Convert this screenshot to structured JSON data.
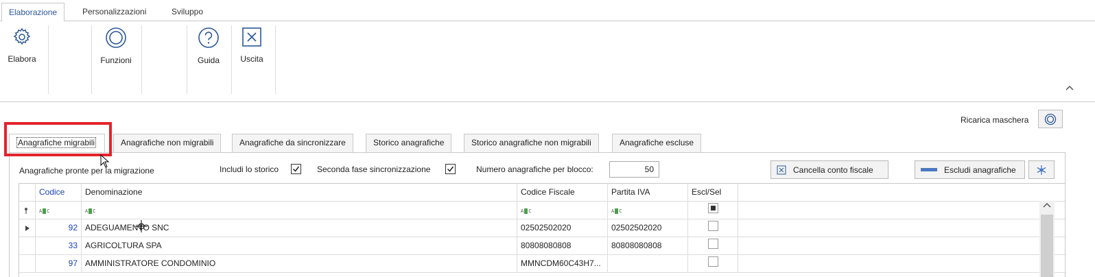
{
  "ribbon": {
    "tabs": [
      "Elaborazione",
      "Personalizzazioni",
      "Sviluppo"
    ],
    "buttons": {
      "elabora": "Elabora",
      "funzioni": "Funzioni",
      "guida": "Guida",
      "uscita": "Uscita"
    }
  },
  "ricarica_label": "Ricarica maschera",
  "tabs": [
    "Anagrafiche migrabili",
    "Anagrafiche non migrabili",
    "Anagrafiche da sincronizzare",
    "Storico anagrafiche",
    "Storico anagrafiche non migrabili",
    "Anagrafiche escluse"
  ],
  "panel": {
    "title": "Anagrafiche pronte per la migrazione",
    "includi_storico": "Includi lo storico",
    "seconda_fase": "Seconda fase sincronizzazione",
    "numero_label": "Numero anagrafiche per blocco:",
    "numero_value": "50",
    "cancella_label": "Cancella conto fiscale",
    "escludi_label": "Escludi anagrafiche"
  },
  "grid": {
    "columns": [
      "Codice",
      "Denominazione",
      "Codice Fiscale",
      "Partita IVA",
      "Escl/Sel"
    ],
    "rows": [
      {
        "codice": "92",
        "denominazione": "ADEGUAMENTO SNC",
        "cf": "02502502020",
        "piva": "02502502020"
      },
      {
        "codice": "33",
        "denominazione": "AGRICOLTURA SPA",
        "cf": "80808080808",
        "piva": "80808080808"
      },
      {
        "codice": "97",
        "denominazione": "AMMINISTRATORE CONDOMINIO",
        "cf": "MMNCDM60C43H7...",
        "piva": ""
      }
    ]
  },
  "colors": {
    "accent": "#2b5797",
    "link": "#1a3fc2",
    "highlight": "#e3242b"
  }
}
